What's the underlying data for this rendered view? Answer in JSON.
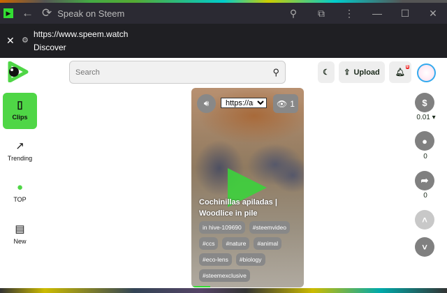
{
  "window": {
    "title": "Speak on Steem"
  },
  "address": {
    "url": "https://www.speem.watch",
    "page_title": "Discover"
  },
  "header": {
    "search_placeholder": "Search",
    "upload_label": "Upload",
    "notification_count": "8"
  },
  "sidebar": {
    "items": [
      {
        "label": "Clips"
      },
      {
        "label": "Trending"
      },
      {
        "label": "TOP"
      },
      {
        "label": "New"
      }
    ]
  },
  "video": {
    "source_option": "https://am",
    "views": "1",
    "title": "Cochinillas apiladas | Woodlice in pile",
    "tags": [
      "in hive-109690",
      "#steemvideo",
      "#ccs",
      "#nature",
      "#animal",
      "#eco-lens",
      "#biology",
      "#steemexclusive"
    ],
    "progress_percent": 17
  },
  "actions": {
    "payout": "0.01",
    "comments": "0",
    "shares": "0"
  },
  "colors": {
    "accent": "#4fd646",
    "titlebar": "#2b2a33"
  }
}
